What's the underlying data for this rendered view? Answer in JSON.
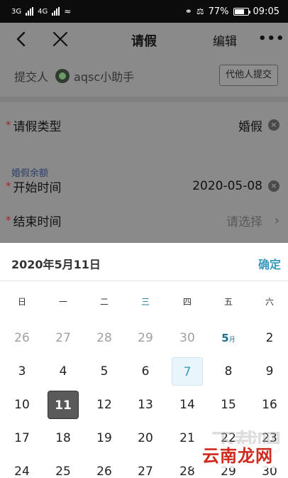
{
  "status_bar": {
    "signal_labels": [
      "3G",
      "4G"
    ],
    "battery": "77%",
    "time": "09:05",
    "battery_level": 0.77
  },
  "nav": {
    "title": "请假",
    "edit_label": "编辑",
    "more_label": "•••"
  },
  "submitter": {
    "label": "提交人",
    "name": "aqsc小助手",
    "proxy_button": "代他人提交"
  },
  "form": {
    "leave_type": {
      "label": "请假类型",
      "value": "婚假"
    },
    "balance_label": "婚假余额",
    "start_time": {
      "label": "开始时间",
      "value": "2020-05-08"
    },
    "end_time": {
      "label": "结束时间",
      "placeholder": "请选择"
    },
    "required_mark": "*"
  },
  "picker": {
    "selected_date": "2020年5月11日",
    "confirm_label": "确定",
    "weekdays": [
      "日",
      "一",
      "二",
      "三",
      "四",
      "五",
      "六"
    ],
    "month_marker": {
      "day": "5",
      "unit": "月"
    },
    "weeks": [
      [
        "26",
        "27",
        "28",
        "29",
        "30",
        "5",
        "2"
      ],
      [
        "3",
        "4",
        "5",
        "6",
        "7",
        "8",
        "9"
      ],
      [
        "10",
        "11",
        "12",
        "13",
        "14",
        "15",
        "16"
      ],
      [
        "17",
        "18",
        "19",
        "20",
        "21",
        "22",
        "23"
      ],
      [
        "24",
        "25",
        "26",
        "27",
        "28",
        "29",
        "30"
      ]
    ],
    "today": "7",
    "selected": "11"
  },
  "watermark": {
    "text": "云南龙网",
    "ghost": "下载吧"
  },
  "colors": {
    "accent": "#3a9bbf",
    "required": "#9a2b2b",
    "selected_bg": "#5a5a5a"
  }
}
